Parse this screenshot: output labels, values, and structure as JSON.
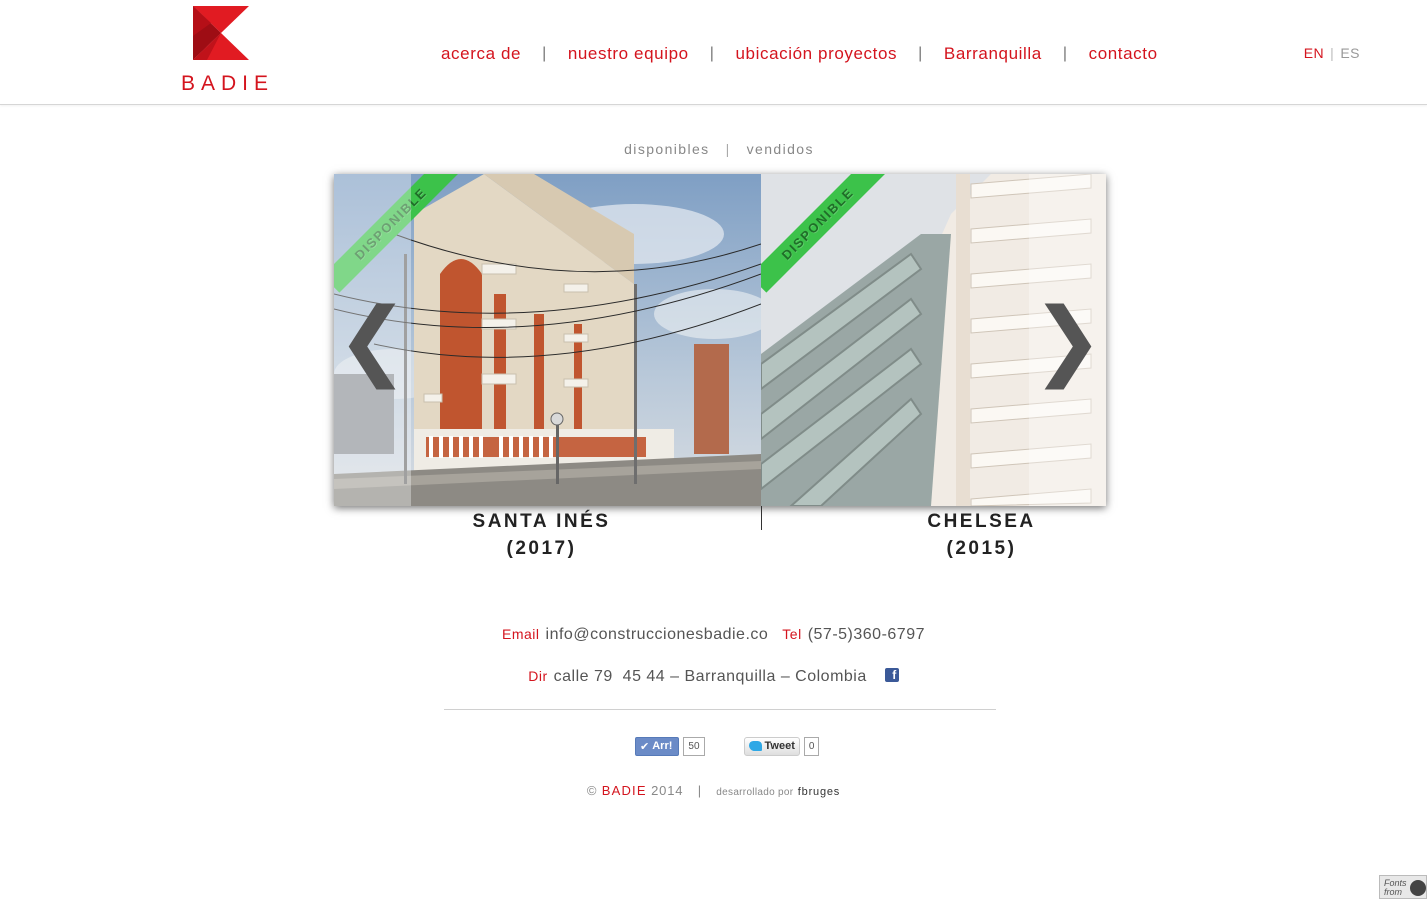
{
  "header": {
    "logo_text": "BADIE",
    "nav": [
      "acerca de",
      "nuestro equipo",
      "ubicación proyectos",
      "Barranquilla",
      "contacto"
    ],
    "nav_separator": "|",
    "lang": {
      "en": "EN",
      "sep": "|",
      "es": "ES"
    }
  },
  "filter": {
    "available": "disponibles",
    "sep": "|",
    "sold": "vendidos"
  },
  "slider": {
    "prev_glyph": "❮",
    "next_glyph": "❯",
    "slides": [
      {
        "ribbon": "DISPONIBLE",
        "name": "SANTA INÉS",
        "year": "(2017)"
      },
      {
        "ribbon": "DISPONIBLE",
        "name": "CHELSEA",
        "year": "(2015)"
      }
    ]
  },
  "contact": {
    "email_label": "Email",
    "email": "info@construccionesbadie.co",
    "tel_label": "Tel",
    "tel": "(57-5)360-6797",
    "dir_label": "Dir",
    "address": "calle 79  45 44 – Barranquilla – Colombia",
    "facebook_icon": "f"
  },
  "share": {
    "arr_label": "Arr!",
    "arr_count": "50",
    "tweet_label": "Tweet",
    "tweet_count": "0"
  },
  "footer": {
    "copyright": "©",
    "brand": "BADIE",
    "year": "2014",
    "sep": "|",
    "developed_by": "desarrollado por",
    "developer": "fbruges"
  },
  "badge": {
    "line1": "Fonts",
    "line2": "from"
  },
  "colors": {
    "accent": "#d4141e",
    "ribbon": "#3cc24a"
  }
}
